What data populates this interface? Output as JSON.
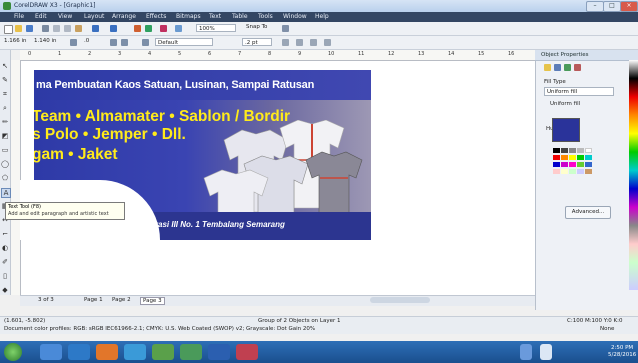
{
  "window": {
    "title": "CorelDRAW X3 - [Graphic1]"
  },
  "menu": [
    "File",
    "Edit",
    "View",
    "Layout",
    "Arrange",
    "Effects",
    "Bitmaps",
    "Text",
    "Table",
    "Tools",
    "Window",
    "Help"
  ],
  "toolbar": {
    "zoom": "100%",
    "snap": "Snap To",
    "size_w": "1.166 in",
    "size_h": "1.140 in",
    "angle": ".0",
    "outline": ".2 pt",
    "corner_style": "Default"
  },
  "ruler_ticks": [
    "0",
    "1",
    "2",
    "3",
    "4",
    "5",
    "6",
    "7",
    "8",
    "9",
    "10",
    "11",
    "12",
    "13",
    "14",
    "15",
    "16"
  ],
  "banner": {
    "headline": "ma Pembuatan Kaos Satuan, Lusinan, Sampai Ratusan",
    "items": [
      "Team  • Almamater • Sablon / Bordir",
      "s Polo  • Jemper       • Dll.",
      "gam     • Jaket"
    ],
    "address": "Jl. Baturasi III No. 1 Tembalang Semarang"
  },
  "tooltip": {
    "title": "Text Tool (F8)",
    "desc": "Add and edit paragraph and artistic text"
  },
  "docker": {
    "title": "Object Properties",
    "fill_type_label": "Fill Type",
    "fill_type_value": "Uniform fill",
    "uniform_fill_label": "Uniform fill",
    "hue_label": "Hue:",
    "advanced_button": "Advanced...",
    "fill_color": "#2a339a"
  },
  "page_tabs": {
    "page_count": "3 of 3",
    "tabs": [
      "Page 1",
      "Page 2",
      "Page 3"
    ]
  },
  "status": {
    "coords": "(1.601, -5.802)",
    "layer_info": "Group of 2 Objects on Layer 1",
    "doc_info": "Document color profiles: RGB: sRGB IEC61966-2.1; CMYK: U.S. Web Coated (SWOP) v2; Grayscale: Dot Gain 20%",
    "fill_info": "C:100 M:100 Y:0 K:0",
    "outline_info": "None"
  },
  "taskbar": {
    "time": "2:50 PM",
    "date": "5/28/2016"
  }
}
